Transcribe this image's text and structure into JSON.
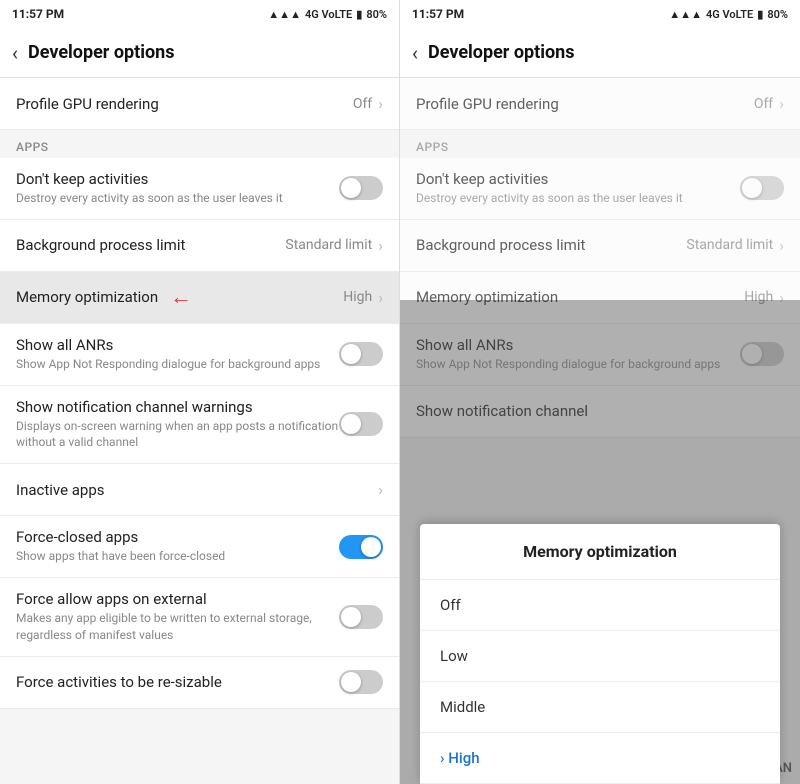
{
  "left_panel": {
    "status_bar": {
      "time": "11:57 PM",
      "signal": "4G VoLTE",
      "battery": "80%"
    },
    "header": {
      "back_label": "‹",
      "title": "Developer options"
    },
    "items": [
      {
        "id": "profile_gpu",
        "title": "Profile GPU rendering",
        "subtitle": "",
        "value": "Off",
        "type": "chevron",
        "section": null
      },
      {
        "id": "apps_section",
        "label": "APPS",
        "type": "section"
      },
      {
        "id": "dont_keep",
        "title": "Don't keep activities",
        "subtitle": "Destroy every activity as soon as the user leaves it",
        "type": "toggle",
        "toggleOn": false,
        "section": null
      },
      {
        "id": "bg_process",
        "title": "Background process limit",
        "subtitle": "",
        "value": "Standard limit",
        "type": "chevron"
      },
      {
        "id": "memory_opt",
        "title": "Memory optimization",
        "subtitle": "",
        "value": "High",
        "type": "chevron",
        "highlighted": true
      },
      {
        "id": "show_anrs",
        "title": "Show all ANRs",
        "subtitle": "Show App Not Responding dialogue for background apps",
        "type": "toggle",
        "toggleOn": false
      },
      {
        "id": "notif_channel",
        "title": "Show notification channel warnings",
        "subtitle": "Displays on-screen warning when an app posts a notification without a valid channel",
        "type": "toggle",
        "toggleOn": false
      },
      {
        "id": "inactive_apps",
        "title": "Inactive apps",
        "subtitle": "",
        "type": "chevron"
      },
      {
        "id": "force_closed",
        "title": "Force-closed apps",
        "subtitle": "Show apps that have been force-closed",
        "type": "toggle",
        "toggleOn": true
      },
      {
        "id": "force_allow",
        "title": "Force allow apps on external",
        "subtitle": "Makes any app eligible to be written to external storage, regardless of manifest values",
        "type": "toggle",
        "toggleOn": false
      },
      {
        "id": "force_resizable",
        "title": "Force activities to be re-sizable",
        "subtitle": "",
        "type": "toggle",
        "toggleOn": false
      }
    ]
  },
  "right_panel": {
    "status_bar": {
      "time": "11:57 PM",
      "signal": "4G VoLTE",
      "battery": "80%"
    },
    "header": {
      "back_label": "‹",
      "title": "Developer options"
    },
    "items": [
      {
        "id": "profile_gpu",
        "title": "Profile GPU rendering",
        "subtitle": "",
        "value": "Off",
        "type": "chevron"
      },
      {
        "id": "apps_section",
        "label": "APPS",
        "type": "section"
      },
      {
        "id": "dont_keep",
        "title": "Don't keep activities",
        "subtitle": "Destroy every activity as soon as the user leaves it",
        "type": "toggle",
        "toggleOn": false
      },
      {
        "id": "bg_process",
        "title": "Background process limit",
        "subtitle": "",
        "value": "Standard limit",
        "type": "chevron"
      },
      {
        "id": "memory_opt",
        "title": "Memory optimization",
        "subtitle": "",
        "value": "High",
        "type": "chevron"
      },
      {
        "id": "show_anrs",
        "title": "Show all ANRs",
        "subtitle": "Show App Not Responding dialogue for background apps",
        "type": "toggle",
        "toggleOn": false
      },
      {
        "id": "notif_channel_partial",
        "title": "Show notification channel",
        "subtitle": "",
        "type": "partial"
      }
    ],
    "dialog": {
      "title": "Memory optimization",
      "options": [
        {
          "label": "Off",
          "selected": false
        },
        {
          "label": "Low",
          "selected": false
        },
        {
          "label": "Middle",
          "selected": false
        },
        {
          "label": "High",
          "selected": true
        }
      ]
    }
  },
  "watermark": "MOBIGYAAN"
}
